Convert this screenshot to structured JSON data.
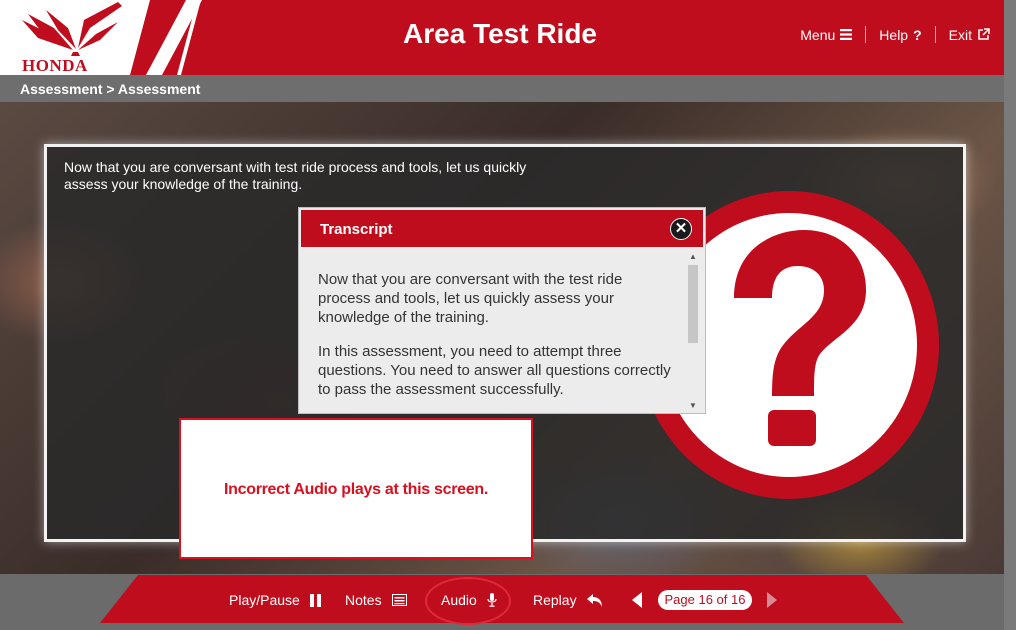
{
  "header": {
    "brand": "HONDA",
    "title": "Area Test Ride",
    "nav": [
      {
        "label": "Menu",
        "icon": "hamburger-icon"
      },
      {
        "label": "Help",
        "icon": "question-icon"
      },
      {
        "label": "Exit",
        "icon": "external-link-icon"
      }
    ]
  },
  "breadcrumb": "Assessment > Assessment",
  "slide": {
    "intro": "Now that you are conversant with test ride process and tools, let us quickly assess your knowledge of the training."
  },
  "transcript": {
    "title": "Transcript",
    "close": "✕",
    "paragraphs": [
      "Now that you are conversant with the test ride process and tools, let us quickly assess your knowledge of the training.",
      "In this assessment, you need to attempt three questions. You need to answer all questions correctly to pass the assessment successfully."
    ]
  },
  "annotation": "Incorrect Audio plays at this screen.",
  "footer": {
    "play_pause": "Play/Pause",
    "notes": "Notes",
    "audio": "Audio",
    "replay": "Replay",
    "page": "Page 16 of 16"
  },
  "colors": {
    "brand_red": "#c00d1e",
    "annotation_red": "#d81020"
  }
}
